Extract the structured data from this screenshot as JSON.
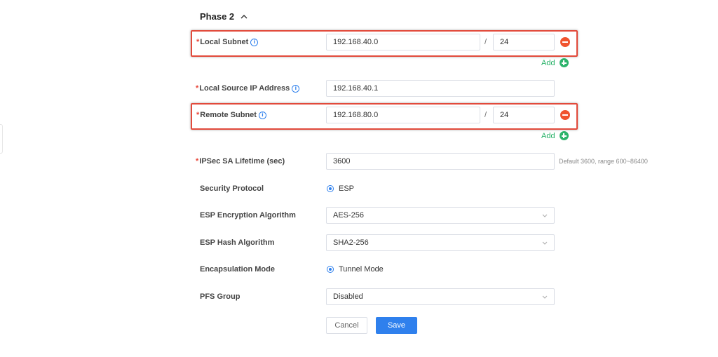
{
  "section": {
    "title": "Phase 2",
    "toggle_icon": "chevron-up-icon"
  },
  "local_subnet": {
    "label": "Local Subnet",
    "ip": "192.168.40.0",
    "separator": "/",
    "mask": "24"
  },
  "add_label": "Add",
  "local_source_ip": {
    "label": "Local Source IP Address",
    "value": "192.168.40.1"
  },
  "remote_subnet": {
    "label": "Remote Subnet",
    "ip": "192.168.80.0",
    "separator": "/",
    "mask": "24"
  },
  "ipsec_lifetime": {
    "label": "IPSec SA Lifetime (sec)",
    "value": "3600",
    "hint": "Default 3600, range 600~86400"
  },
  "security_protocol": {
    "label": "Security Protocol",
    "option": "ESP"
  },
  "esp_encryption": {
    "label": "ESP Encryption Algorithm",
    "value": "AES-256"
  },
  "esp_hash": {
    "label": "ESP Hash Algorithm",
    "value": "SHA2-256"
  },
  "encapsulation": {
    "label": "Encapsulation Mode",
    "option": "Tunnel Mode"
  },
  "pfs_group": {
    "label": "PFS Group",
    "value": "Disabled"
  },
  "actions": {
    "cancel": "Cancel",
    "save": "Save"
  },
  "colors": {
    "required": "#e8463a",
    "accent": "#2f80ed",
    "add": "#2cb36b",
    "remove": "#f0532e",
    "highlight": "#e24a3b"
  }
}
